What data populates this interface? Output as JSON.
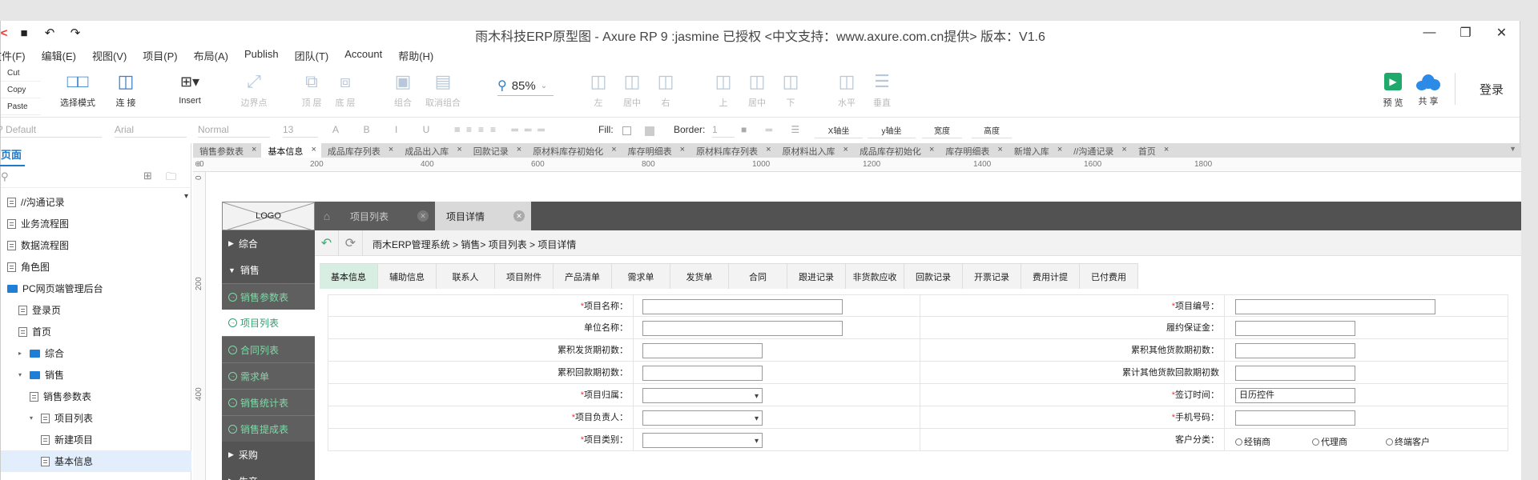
{
  "window": {
    "title": "雨木科技ERP原型图 - Axure RP 9 :jasmine 已授权 <中文支持：www.axure.com.cn提供> 版本：V1.6",
    "controls": {
      "minimize": "—",
      "maximize": "❐",
      "close": "✕"
    }
  },
  "quick_icons": {
    "redmark": "<",
    "save": "▪",
    "undo": "↶",
    "redo": "↷"
  },
  "menu": [
    "文件(F)",
    "编辑(E)",
    "视图(V)",
    "项目(P)",
    "布局(A)",
    "Publish",
    "团队(T)",
    "Account",
    "帮助(H)"
  ],
  "clipboard": {
    "cut": "Cut",
    "copy": "Copy",
    "paste": "Paste"
  },
  "toolbar": {
    "select_mode": "选择模式",
    "connect": "连 接",
    "insert": "Insert",
    "boundary": "边界点",
    "top_layer": "顶 层",
    "bottom_layer": "底 层",
    "group": "组合",
    "ungroup": "取消组合",
    "zoom": "85%",
    "align_left": "左",
    "align_center": "居中",
    "align_right": "右",
    "align_top": "上",
    "align_middle": "居中",
    "align_bottom": "下",
    "horizontal": "水平",
    "vertical": "垂直",
    "preview": "预 览",
    "share": "共 享",
    "login": "登录"
  },
  "format": {
    "style": "Default",
    "font": "Arial",
    "weight": "Normal",
    "size": "13",
    "fill": "Fill:",
    "border": "Border:",
    "border_val": "1",
    "x": "X轴坐",
    "y": "y轴坐",
    "w": "宽度",
    "h": "高度"
  },
  "left_panel": {
    "tab": "页面",
    "tree": [
      {
        "label": "//沟通记录",
        "type": "page",
        "indent": 0
      },
      {
        "label": "业务流程图",
        "type": "page",
        "indent": 0
      },
      {
        "label": "数据流程图",
        "type": "page",
        "indent": 0
      },
      {
        "label": "角色图",
        "type": "page",
        "indent": 0
      },
      {
        "label": "PC网页端管理后台",
        "type": "folder",
        "indent": 0
      },
      {
        "label": "登录页",
        "type": "page",
        "indent": 1
      },
      {
        "label": "首页",
        "type": "page",
        "indent": 1
      },
      {
        "label": "综合",
        "type": "folder",
        "indent": 1,
        "arrow": "▸"
      },
      {
        "label": "销售",
        "type": "folder",
        "indent": 1,
        "arrow": "▾"
      },
      {
        "label": "销售参数表",
        "type": "page",
        "indent": 2
      },
      {
        "label": "项目列表",
        "type": "page",
        "indent": 2,
        "arrow": "▾"
      },
      {
        "label": "新建项目",
        "type": "page",
        "indent": 3
      },
      {
        "label": "基本信息",
        "type": "page",
        "indent": 3,
        "selected": true
      }
    ]
  },
  "doc_tabs": [
    {
      "label": "销售参数表",
      "active": false
    },
    {
      "label": "基本信息",
      "active": true
    },
    {
      "label": "成品库存列表",
      "active": false
    },
    {
      "label": "成品出入库",
      "active": false
    },
    {
      "label": "回款记录",
      "active": false
    },
    {
      "label": "原材料库存初始化",
      "active": false
    },
    {
      "label": "库存明细表",
      "active": false
    },
    {
      "label": "原材料库存列表",
      "active": false
    },
    {
      "label": "原材料出入库",
      "active": false
    },
    {
      "label": "成品库存初始化",
      "active": false
    },
    {
      "label": "库存明细表",
      "active": false
    },
    {
      "label": "新增入库",
      "active": false
    },
    {
      "label": "//沟通记录",
      "active": false
    },
    {
      "label": "首页",
      "active": false
    }
  ],
  "ruler": [
    "0",
    "200",
    "400",
    "600",
    "800",
    "1000",
    "1200",
    "1400",
    "1600",
    "1800"
  ],
  "ruler_v": [
    "0",
    "200",
    "400"
  ],
  "proto": {
    "logo": "LOGO",
    "tab_list": "项目列表",
    "tab_detail": "项目详情",
    "breadcrumb": "雨木ERP管理系统 > 销售> 项目列表 > 项目详情",
    "side": [
      {
        "label": "综合",
        "kind": "grp",
        "tri": "▶"
      },
      {
        "label": "销售",
        "kind": "grp",
        "tri": "▼"
      },
      {
        "label": "销售参数表",
        "kind": "sub"
      },
      {
        "label": "项目列表",
        "kind": "active"
      },
      {
        "label": "合同列表",
        "kind": "sub"
      },
      {
        "label": "需求单",
        "kind": "sub"
      },
      {
        "label": "销售统计表",
        "kind": "sub"
      },
      {
        "label": "销售提成表",
        "kind": "sub"
      },
      {
        "label": "采购",
        "kind": "grp",
        "tri": "▶"
      },
      {
        "label": "生产",
        "kind": "grp",
        "tri": "▶"
      }
    ],
    "detail_tabs": [
      "基本信息",
      "辅助信息",
      "联系人",
      "项目附件",
      "产品清单",
      "需求单",
      "发货单",
      "合同",
      "跟进记录",
      "非货款应收",
      "回款记录",
      "开票记录",
      "费用计提",
      "已付费用"
    ],
    "form": [
      {
        "l_label": "项目名称：",
        "l_req": true,
        "l_input": "wide",
        "r_label": "项目编号：",
        "r_req": true,
        "r_input": "wide",
        "r_value": ""
      },
      {
        "l_label": "单位名称：",
        "l_req": false,
        "l_input": "wide",
        "r_label": "履约保证金：",
        "r_req": false,
        "r_input": "short",
        "r_value": ""
      },
      {
        "l_label": "累积发货期初数：",
        "l_req": false,
        "l_input": "short",
        "r_label": "累积其他货款期初数：",
        "r_req": false,
        "r_input": "short",
        "r_value": ""
      },
      {
        "l_label": "累积回款期初数：",
        "l_req": false,
        "l_input": "short",
        "r_label": "累计其他货款回款期初数",
        "r_req": false,
        "r_input": "short",
        "r_value": ""
      },
      {
        "l_label": "项目归属：",
        "l_req": true,
        "l_input": "select",
        "r_label": "签订时间：",
        "r_req": true,
        "r_input": "short",
        "r_value": "日历控件"
      },
      {
        "l_label": "项目负责人：",
        "l_req": true,
        "l_input": "select",
        "r_label": "手机号码：",
        "r_req": true,
        "r_input": "short",
        "r_value": ""
      },
      {
        "l_label": "项目类别：",
        "l_req": true,
        "l_input": "select",
        "r_label": "客户分类：",
        "r_req": false,
        "r_input": "radio",
        "r_value": ""
      }
    ],
    "radios": [
      "经销商",
      "代理商",
      "终端客户"
    ]
  }
}
